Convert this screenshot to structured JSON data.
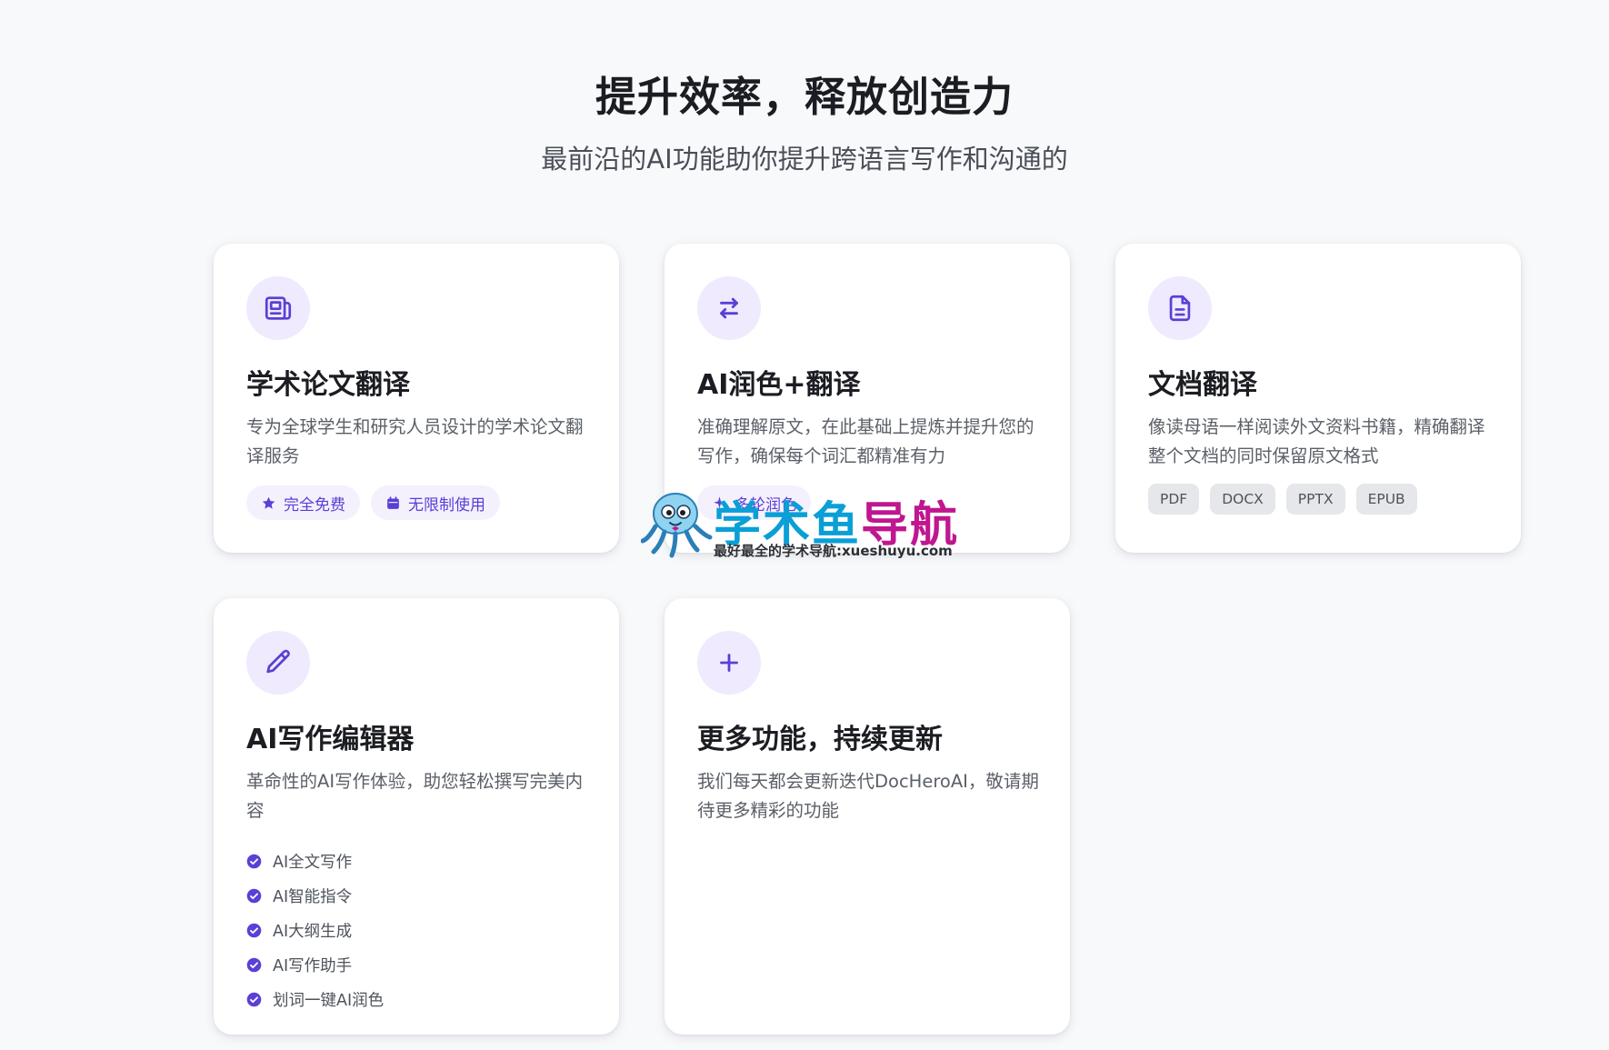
{
  "hero": {
    "title": "提升效率，释放创造力",
    "subtitle": "最前沿的AI功能助你提升跨语言写作和沟通的"
  },
  "colors": {
    "accent": "#5b3fd6",
    "icon_bg": "#efeafd",
    "tag_gray_bg": "#e6e7ea",
    "watermark_blue": "#0a9fd6",
    "watermark_magenta": "#c0168f"
  },
  "cards": [
    {
      "icon": "newspaper-icon",
      "title": "学术论文翻译",
      "desc": "专为全球学生和研究人员设计的学术论文翻译服务",
      "pills": [
        {
          "icon": "star-icon",
          "label": "完全免费"
        },
        {
          "icon": "calendar-icon",
          "label": "无限制使用"
        }
      ]
    },
    {
      "icon": "swap-arrows-icon",
      "title": "AI润色+翻译",
      "desc": "准确理解原文，在此基础上提炼并提升您的写作，确保每个词汇都精准有力",
      "pills": [
        {
          "icon": "sparkle-icon",
          "label": "多轮润色"
        }
      ]
    },
    {
      "icon": "document-icon",
      "title": "文档翻译",
      "desc": "像读母语一样阅读外文资料书籍，精确翻译整个文档的同时保留原文格式",
      "tags": [
        "PDF",
        "DOCX",
        "PPTX",
        "EPUB"
      ]
    },
    {
      "icon": "pencil-icon",
      "title": "AI写作编辑器",
      "desc": "革命性的AI写作体验，助您轻松撰写完美内容",
      "features": [
        "AI全文写作",
        "AI智能指令",
        "AI大纲生成",
        "AI写作助手",
        "划词一键AI润色"
      ]
    },
    {
      "icon": "plus-icon",
      "title": "更多功能，持续更新",
      "desc": "我们每天都会更新迭代DocHeroAI，敬请期待更多精彩的功能"
    }
  ],
  "watermark": {
    "part1": "学术鱼",
    "part2": "导航",
    "url_text": "最好最全的学术导航:xueshuyu.com"
  }
}
